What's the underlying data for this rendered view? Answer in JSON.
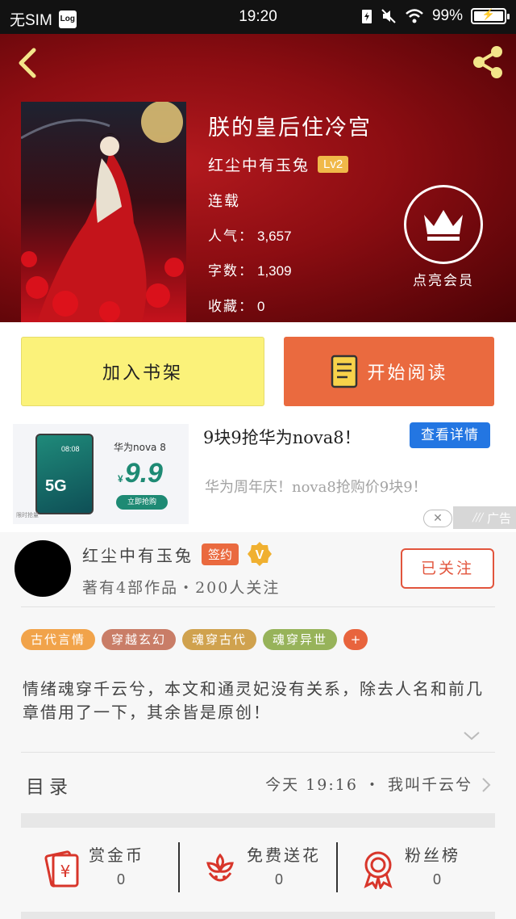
{
  "status_bar": {
    "carrier": "无SIM",
    "log_label": "Log",
    "time": "19:20",
    "battery": "99%",
    "battery_level": 0.99
  },
  "book": {
    "title": "朕的皇后住冷宫",
    "author": "红尘中有玉兔",
    "level": "Lv2",
    "status": "连载",
    "stats": [
      {
        "label": "人气：",
        "value": "3,657"
      },
      {
        "label": "字数：",
        "value": "1,309"
      },
      {
        "label": "收藏：",
        "value": "0"
      }
    ],
    "vip_label": "点亮会员"
  },
  "actions": {
    "add_shelf": "加入书架",
    "start_read": "开始阅读"
  },
  "ad": {
    "image_model": "华为nova 8",
    "image_price": "9.9",
    "image_currency": "¥",
    "image_buy": "立即抢购",
    "image_limit": "限时抢量",
    "phone_label": "5G",
    "phone_time": "08:08",
    "title": "9块9抢华为nova8！",
    "detail_button": "查看详情",
    "description": "华为周年庆！nova8抢购价9块9！",
    "close": "✕",
    "tag": "广告"
  },
  "author_panel": {
    "name": "红尘中有玉兔",
    "sign_badge": "签约",
    "v_badge": "V",
    "works": "著有4部作品・200人关注",
    "follow_button": "已关注",
    "tags": [
      {
        "label": "古代言情",
        "color": "#f1a34a"
      },
      {
        "label": "穿越玄幻",
        "color": "#c97d67"
      },
      {
        "label": "魂穿古代",
        "color": "#d0a24e"
      },
      {
        "label": "魂穿异世",
        "color": "#97b35a"
      }
    ],
    "tag_more": "+",
    "description": "情绪魂穿千云兮，本文和通灵妃没有关系，除去人名和前几章借用了一下，其余皆是原创！",
    "toc_label": "目录",
    "toc_latest": "今天 19:16 ・ 我叫千云兮",
    "bottom_items": [
      {
        "label": "赏金币",
        "count": "0",
        "icon": "red-envelope-icon"
      },
      {
        "label": "免费送花",
        "count": "0",
        "icon": "flower-icon"
      },
      {
        "label": "粉丝榜",
        "count": "0",
        "icon": "medal-icon"
      }
    ]
  },
  "colors": {
    "header_red": "#8c0d12",
    "shelf_yellow": "#fbf27a",
    "read_orange": "#ea6a3f",
    "ad_blue": "#2376e2",
    "follow_red": "#e2553d"
  }
}
